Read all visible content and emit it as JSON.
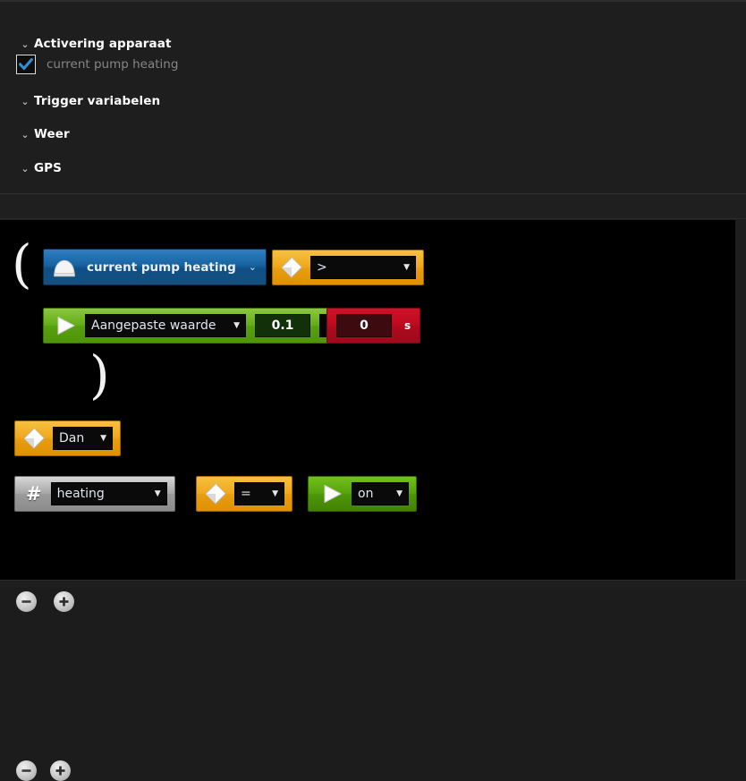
{
  "tree": {
    "groups": [
      {
        "label": "Activering apparaat",
        "chevron": "chevron-down-icon",
        "children": [
          {
            "label": "current pump heating",
            "checked": true
          }
        ]
      },
      {
        "label": "Trigger variabelen",
        "chevron": "chevron-down-icon",
        "children": []
      },
      {
        "label": "Weer",
        "chevron": "chevron-down-icon",
        "children": []
      },
      {
        "label": "GPS",
        "chevron": "chevron-down-icon",
        "children": []
      }
    ],
    "chevron_glyph": "⌄"
  },
  "editor": {
    "open_paren": "(",
    "close_paren": ")",
    "caret_glyph": "▼",
    "blue_caret_glyph": "⌄",
    "condition": {
      "device_block": {
        "icon": "dome-icon",
        "label": "current pump heating"
      },
      "operator_block": {
        "icon": "diamond-icon",
        "value": ">"
      },
      "value_block": {
        "icon": "play-icon",
        "source": "Aangepaste waarde",
        "number": "0.1",
        "duration": "0",
        "duration_unit": "s"
      }
    },
    "then_block": {
      "icon": "diamond-icon",
      "label": "Dan"
    },
    "action": {
      "variable_block": {
        "icon": "hash-icon",
        "label": "heating"
      },
      "operator_block": {
        "icon": "diamond-icon",
        "value": "="
      },
      "state_block": {
        "icon": "play-icon",
        "value": "on"
      }
    },
    "buttons": {
      "remove": "−",
      "add": "+"
    }
  },
  "colors": {
    "device_blue": "#18639f",
    "operator_orange": "#f0a81d",
    "action_green": "#63ae17",
    "timer_red": "#bd0a20",
    "variable_gray": "#a8a8a8",
    "panel_bg": "#1e1e1e",
    "canvas_bg": "#000000",
    "checkbox_accent": "#2f8fd8"
  }
}
